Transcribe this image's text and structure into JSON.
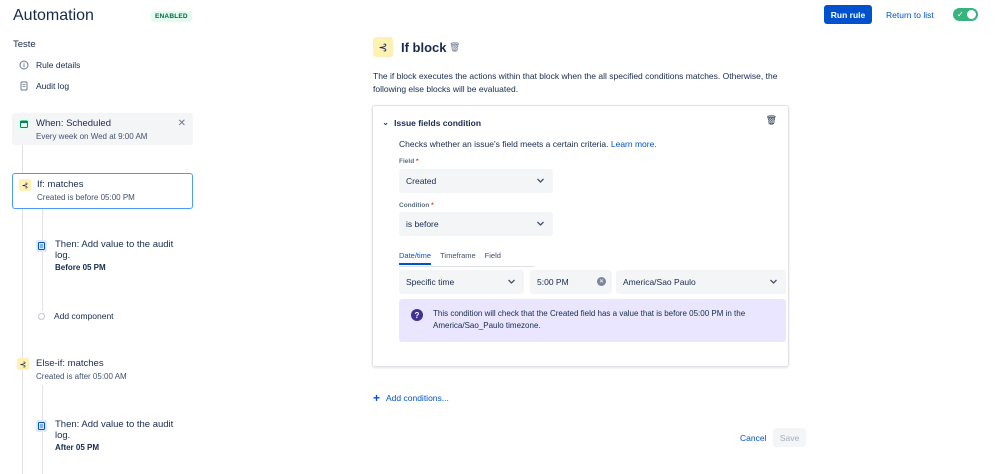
{
  "header": {
    "title": "Automation",
    "status_badge": "ENABLED",
    "run_rule": "Run rule",
    "return_to_list": "Return to list"
  },
  "sidebar": {
    "rule_name": "Teste",
    "links": [
      {
        "label": "Rule details",
        "icon": "info-icon"
      },
      {
        "label": "Audit log",
        "icon": "document-icon"
      }
    ],
    "trigger": {
      "title": "When: Scheduled",
      "subtitle": "Every week on Wed at 9:00 AM"
    },
    "if_block": {
      "title": "If: matches",
      "subtitle": "Created is before 05:00 PM"
    },
    "if_action": {
      "title": "Then: Add value to the audit log.",
      "detail": "Before 05 PM"
    },
    "add_component": "Add component",
    "elseif_block": {
      "title": "Else-if: matches",
      "subtitle": "Created is after 05:00 AM"
    },
    "elseif_action": {
      "title": "Then: Add value to the audit log.",
      "detail": "After 05 PM"
    }
  },
  "main": {
    "title": "If block",
    "description": "The if block executes the actions within that block when the all specified conditions matches. Otherwise, the following else blocks will be evaluated.",
    "condition": {
      "header": "Issue fields condition",
      "description": "Checks whether an issue's field meets a certain criteria.",
      "learn_more": "Learn more.",
      "field_label": "Field",
      "field_value": "Created",
      "condition_label": "Condition",
      "condition_value": "is before",
      "tabs": [
        "Date/time",
        "Timeframe",
        "Field"
      ],
      "active_tab": "Date/time",
      "mode_value": "Specific time",
      "time_value": "5:00 PM",
      "timezone_value": "America/Sao Paulo",
      "info": "This condition will check that the Created field has a value that is before 05:00 PM in the America/Sao_Paulo timezone."
    },
    "add_conditions": "Add conditions...",
    "cancel": "Cancel",
    "save": "Save"
  },
  "colors": {
    "primary": "#0052cc",
    "success": "#36b37e",
    "selected_border": "#4c9aff",
    "info_bg": "#eae6ff"
  }
}
